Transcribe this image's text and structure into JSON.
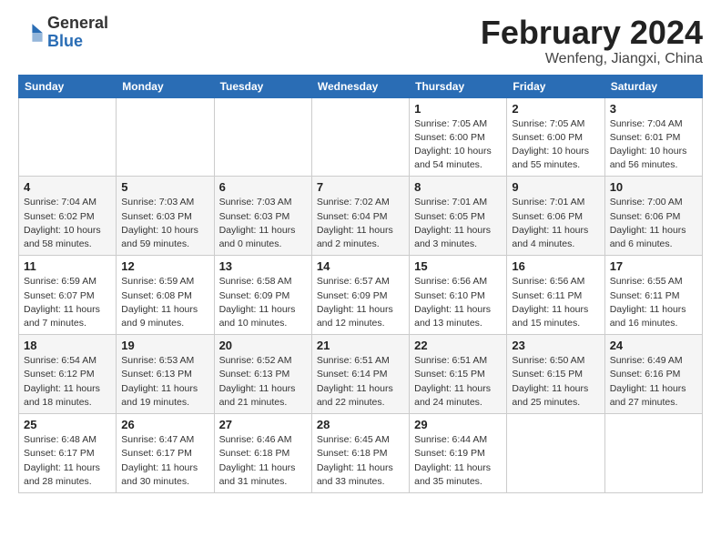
{
  "logo": {
    "general": "General",
    "blue": "Blue"
  },
  "header": {
    "month": "February 2024",
    "location": "Wenfeng, Jiangxi, China"
  },
  "weekdays": [
    "Sunday",
    "Monday",
    "Tuesday",
    "Wednesday",
    "Thursday",
    "Friday",
    "Saturday"
  ],
  "weeks": [
    [
      {
        "day": "",
        "info": ""
      },
      {
        "day": "",
        "info": ""
      },
      {
        "day": "",
        "info": ""
      },
      {
        "day": "",
        "info": ""
      },
      {
        "day": "1",
        "info": "Sunrise: 7:05 AM\nSunset: 6:00 PM\nDaylight: 10 hours\nand 54 minutes."
      },
      {
        "day": "2",
        "info": "Sunrise: 7:05 AM\nSunset: 6:00 PM\nDaylight: 10 hours\nand 55 minutes."
      },
      {
        "day": "3",
        "info": "Sunrise: 7:04 AM\nSunset: 6:01 PM\nDaylight: 10 hours\nand 56 minutes."
      }
    ],
    [
      {
        "day": "4",
        "info": "Sunrise: 7:04 AM\nSunset: 6:02 PM\nDaylight: 10 hours\nand 58 minutes."
      },
      {
        "day": "5",
        "info": "Sunrise: 7:03 AM\nSunset: 6:03 PM\nDaylight: 10 hours\nand 59 minutes."
      },
      {
        "day": "6",
        "info": "Sunrise: 7:03 AM\nSunset: 6:03 PM\nDaylight: 11 hours\nand 0 minutes."
      },
      {
        "day": "7",
        "info": "Sunrise: 7:02 AM\nSunset: 6:04 PM\nDaylight: 11 hours\nand 2 minutes."
      },
      {
        "day": "8",
        "info": "Sunrise: 7:01 AM\nSunset: 6:05 PM\nDaylight: 11 hours\nand 3 minutes."
      },
      {
        "day": "9",
        "info": "Sunrise: 7:01 AM\nSunset: 6:06 PM\nDaylight: 11 hours\nand 4 minutes."
      },
      {
        "day": "10",
        "info": "Sunrise: 7:00 AM\nSunset: 6:06 PM\nDaylight: 11 hours\nand 6 minutes."
      }
    ],
    [
      {
        "day": "11",
        "info": "Sunrise: 6:59 AM\nSunset: 6:07 PM\nDaylight: 11 hours\nand 7 minutes."
      },
      {
        "day": "12",
        "info": "Sunrise: 6:59 AM\nSunset: 6:08 PM\nDaylight: 11 hours\nand 9 minutes."
      },
      {
        "day": "13",
        "info": "Sunrise: 6:58 AM\nSunset: 6:09 PM\nDaylight: 11 hours\nand 10 minutes."
      },
      {
        "day": "14",
        "info": "Sunrise: 6:57 AM\nSunset: 6:09 PM\nDaylight: 11 hours\nand 12 minutes."
      },
      {
        "day": "15",
        "info": "Sunrise: 6:56 AM\nSunset: 6:10 PM\nDaylight: 11 hours\nand 13 minutes."
      },
      {
        "day": "16",
        "info": "Sunrise: 6:56 AM\nSunset: 6:11 PM\nDaylight: 11 hours\nand 15 minutes."
      },
      {
        "day": "17",
        "info": "Sunrise: 6:55 AM\nSunset: 6:11 PM\nDaylight: 11 hours\nand 16 minutes."
      }
    ],
    [
      {
        "day": "18",
        "info": "Sunrise: 6:54 AM\nSunset: 6:12 PM\nDaylight: 11 hours\nand 18 minutes."
      },
      {
        "day": "19",
        "info": "Sunrise: 6:53 AM\nSunset: 6:13 PM\nDaylight: 11 hours\nand 19 minutes."
      },
      {
        "day": "20",
        "info": "Sunrise: 6:52 AM\nSunset: 6:13 PM\nDaylight: 11 hours\nand 21 minutes."
      },
      {
        "day": "21",
        "info": "Sunrise: 6:51 AM\nSunset: 6:14 PM\nDaylight: 11 hours\nand 22 minutes."
      },
      {
        "day": "22",
        "info": "Sunrise: 6:51 AM\nSunset: 6:15 PM\nDaylight: 11 hours\nand 24 minutes."
      },
      {
        "day": "23",
        "info": "Sunrise: 6:50 AM\nSunset: 6:15 PM\nDaylight: 11 hours\nand 25 minutes."
      },
      {
        "day": "24",
        "info": "Sunrise: 6:49 AM\nSunset: 6:16 PM\nDaylight: 11 hours\nand 27 minutes."
      }
    ],
    [
      {
        "day": "25",
        "info": "Sunrise: 6:48 AM\nSunset: 6:17 PM\nDaylight: 11 hours\nand 28 minutes."
      },
      {
        "day": "26",
        "info": "Sunrise: 6:47 AM\nSunset: 6:17 PM\nDaylight: 11 hours\nand 30 minutes."
      },
      {
        "day": "27",
        "info": "Sunrise: 6:46 AM\nSunset: 6:18 PM\nDaylight: 11 hours\nand 31 minutes."
      },
      {
        "day": "28",
        "info": "Sunrise: 6:45 AM\nSunset: 6:18 PM\nDaylight: 11 hours\nand 33 minutes."
      },
      {
        "day": "29",
        "info": "Sunrise: 6:44 AM\nSunset: 6:19 PM\nDaylight: 11 hours\nand 35 minutes."
      },
      {
        "day": "",
        "info": ""
      },
      {
        "day": "",
        "info": ""
      }
    ]
  ]
}
